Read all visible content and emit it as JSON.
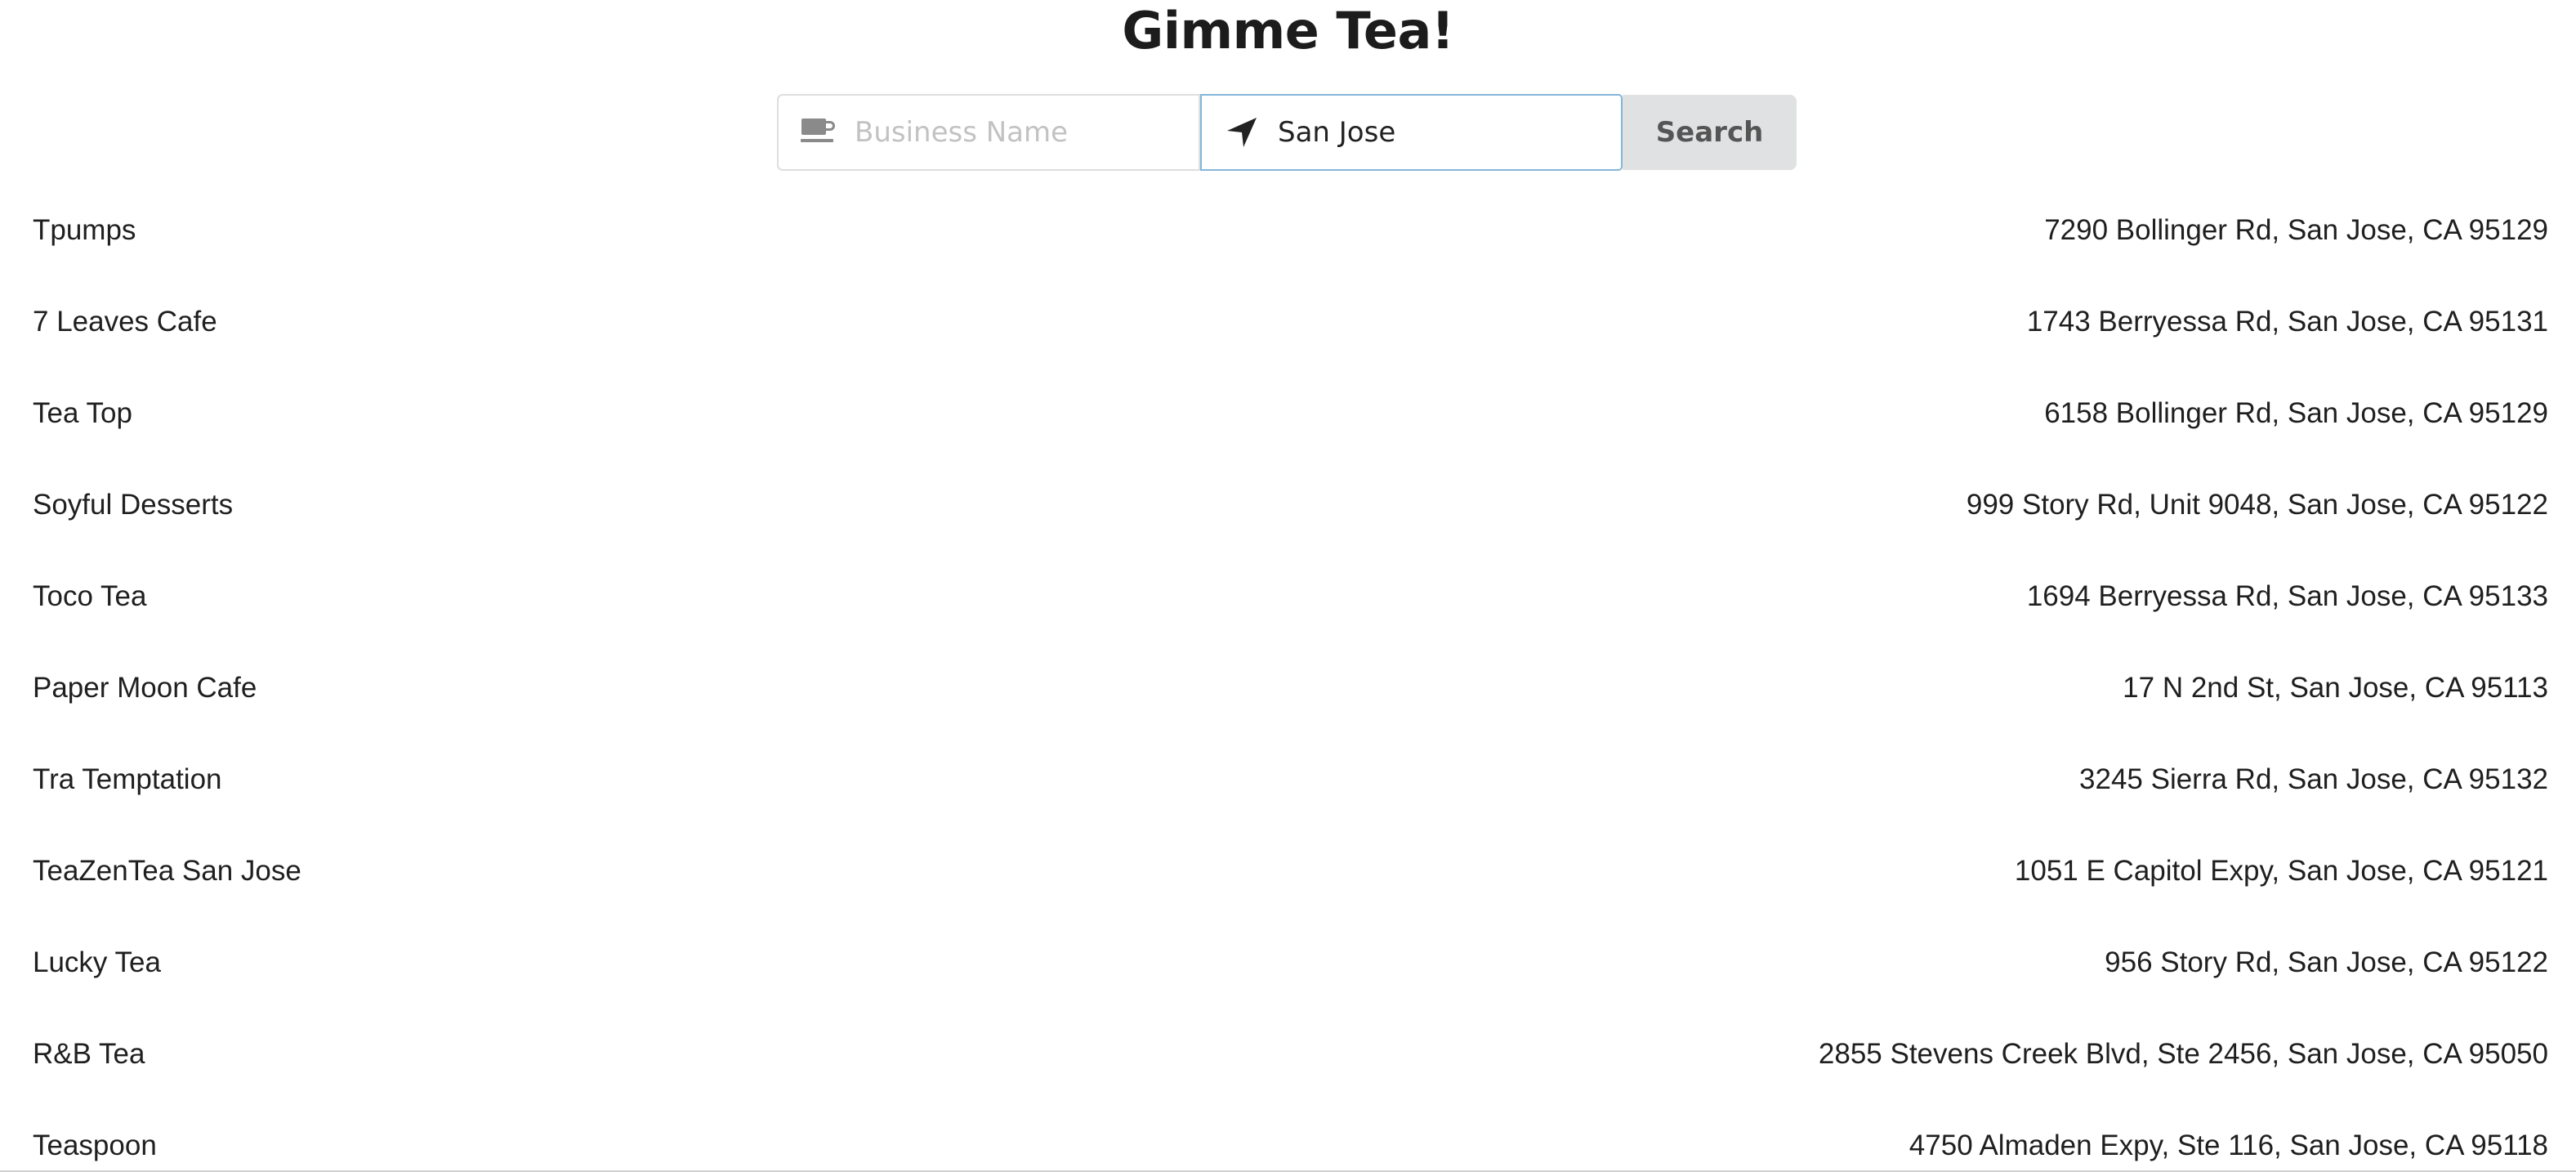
{
  "header": {
    "title": "Gimme Tea!"
  },
  "search": {
    "business_placeholder": "Business Name",
    "business_value": "",
    "business_icon": "coffee-cup-icon",
    "location_value": "San Jose",
    "location_icon": "location-arrow-icon",
    "button_label": "Search"
  },
  "results": [
    {
      "name": "Tpumps",
      "address": "7290 Bollinger Rd, San Jose, CA 95129"
    },
    {
      "name": "7 Leaves Cafe",
      "address": "1743 Berryessa Rd, San Jose, CA 95131"
    },
    {
      "name": "Tea Top",
      "address": "6158 Bollinger Rd, San Jose, CA 95129"
    },
    {
      "name": "Soyful Desserts",
      "address": "999 Story Rd, Unit 9048, San Jose, CA 95122"
    },
    {
      "name": "Toco Tea",
      "address": "1694 Berryessa Rd, San Jose, CA 95133"
    },
    {
      "name": "Paper Moon Cafe",
      "address": "17 N 2nd St, San Jose, CA 95113"
    },
    {
      "name": "Tra Temptation",
      "address": "3245 Sierra Rd, San Jose, CA 95132"
    },
    {
      "name": "TeaZenTea San Jose",
      "address": "1051 E Capitol Expy, San Jose, CA 95121"
    },
    {
      "name": "Lucky Tea",
      "address": "956 Story Rd, San Jose, CA 95122"
    },
    {
      "name": "R&B Tea",
      "address": "2855 Stevens Creek Blvd, Ste 2456, San Jose, CA 95050"
    },
    {
      "name": "Teaspoon",
      "address": "4750 Almaden Expy, Ste 116, San Jose, CA 95118"
    }
  ],
  "colors": {
    "focus_border": "#84b7d9",
    "button_bg": "#e0e1e2",
    "button_text": "#555555",
    "placeholder": "#c2c2c2"
  }
}
